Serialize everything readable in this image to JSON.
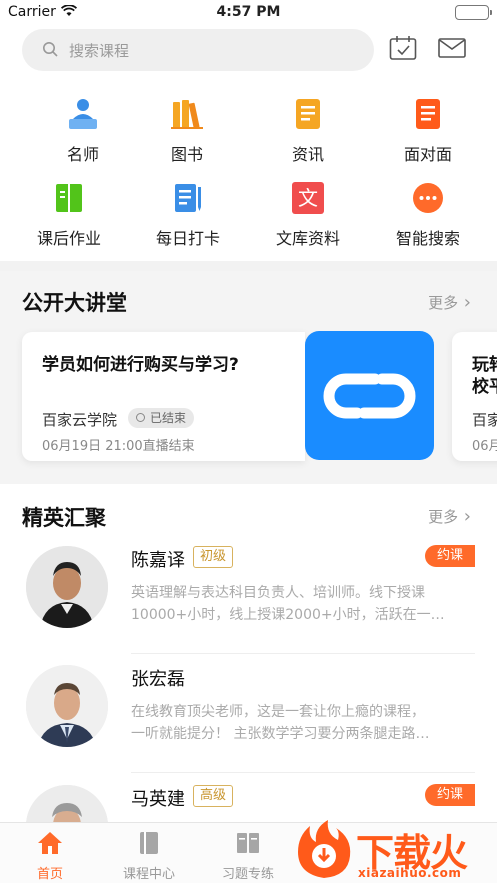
{
  "status_bar": {
    "carrier": "Carrier",
    "time": "4:57 PM"
  },
  "search": {
    "placeholder": "搜索课程"
  },
  "quick_menu": [
    {
      "label": "名师",
      "icon": "teacher-icon",
      "color": "#3a8ee6"
    },
    {
      "label": "图书",
      "icon": "books-icon",
      "color": "#f5a623"
    },
    {
      "label": "资讯",
      "icon": "news-icon",
      "color": "#f5a623"
    },
    {
      "label": "面对面",
      "icon": "document-icon",
      "color": "#ff5a1a"
    },
    {
      "label": "课后作业",
      "icon": "homework-icon",
      "color": "#52c41a"
    },
    {
      "label": "每日打卡",
      "icon": "checkin-icon",
      "color": "#3a8ee6"
    },
    {
      "label": "文库资料",
      "icon": "library-icon",
      "color": "#f04d4d"
    },
    {
      "label": "智能搜索",
      "icon": "chat-search-icon",
      "color": "#ff6a2a"
    }
  ],
  "lectures": {
    "title": "公开大讲堂",
    "more": "更多",
    "items": [
      {
        "title": "学员如何进行购买与学习?",
        "org": "百家云学院",
        "status": "已结束",
        "meta": "06月19日 21:00直播结束"
      },
      {
        "title": "玩转",
        "title2": "校平",
        "org": "百家",
        "meta": "06月"
      }
    ]
  },
  "elite": {
    "title": "精英汇聚",
    "more": "更多",
    "teachers": [
      {
        "name": "陈嘉译",
        "level": "初级",
        "book": "约课",
        "desc1": "英语理解与表达科目负责人、培训师。线下授课",
        "desc2": "10000+小时，线上授课2000+小时，活跃在一…"
      },
      {
        "name": "张宏磊",
        "level": "",
        "book": "",
        "desc1": "在线教育顶尖老师，这是一套让你上瘾的课程，",
        "desc2": "一听就能提分！ 主张数学学习要分两条腿走路…"
      },
      {
        "name": "马英建",
        "level": "高级",
        "book": "约课",
        "desc1": "",
        "desc2": ""
      }
    ]
  },
  "tabbar": [
    {
      "label": "首页",
      "icon": "home-icon",
      "active": true
    },
    {
      "label": "课程中心",
      "icon": "course-icon",
      "active": false
    },
    {
      "label": "习题专练",
      "icon": "exercise-icon",
      "active": false
    }
  ],
  "watermark": {
    "text": "下载火",
    "domain": "xiazaihuo.com"
  },
  "colors": {
    "accent": "#ff6a2a",
    "brand_blue": "#1a8cff"
  }
}
